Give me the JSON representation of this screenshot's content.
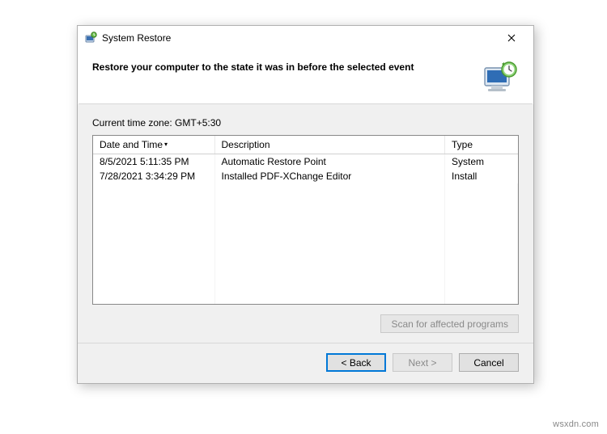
{
  "window": {
    "title": "System Restore"
  },
  "header": {
    "heading": "Restore your computer to the state it was in before the selected event"
  },
  "timezone_label": "Current time zone: GMT+5:30",
  "table": {
    "columns": {
      "date": "Date and Time",
      "description": "Description",
      "type": "Type"
    },
    "rows": [
      {
        "date": "8/5/2021 5:11:35 PM",
        "description": "Automatic Restore Point",
        "type": "System"
      },
      {
        "date": "7/28/2021 3:34:29 PM",
        "description": "Installed PDF-XChange Editor",
        "type": "Install"
      }
    ]
  },
  "buttons": {
    "scan": "Scan for affected programs",
    "back": "< Back",
    "next": "Next >",
    "cancel": "Cancel"
  },
  "watermark": "wsxdn.com"
}
